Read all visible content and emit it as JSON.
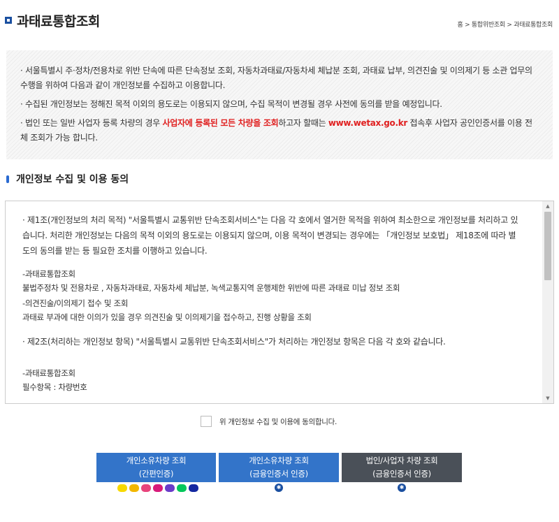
{
  "header": {
    "title": "과태료통합조회",
    "breadcrumb": "홈 > 통합위반조회 > 과태료통합조회"
  },
  "notice": {
    "line1": "· 서울특별시 주·정차/전용차로 위반 단속에 따른 단속정보 조회, 자동차과태료/자동차세 체납분 조회, 과태료 납부, 의견진술 및 이의제기 등 소관 업무의 수행을 위하여 다음과 같이 개인정보를 수집하고 이용합니다.",
    "line2": "· 수집된 개인정보는 정해진 목적 이외의 용도로는 이용되지 않으며, 수집 목적이 변경될 경우 사전에 동의를 받을 예정입니다.",
    "line3_a": "· 법인 또는 일반 사업자 등록 차량의 경우 ",
    "line3_red": "사업자에 등록된 모든 차량을 조회",
    "line3_b": "하고자 할때는 ",
    "line3_link": "www.wetax.go.kr",
    "line3_c": " 접속후 사업자 공인인증서를 이용 전체 조회가 가능 합니다."
  },
  "section": {
    "title": "개인정보 수집 및 이용 동의"
  },
  "agreement": {
    "p1": "· 제1조(개인정보의 처리 목적) \"서울특별시 교통위반 단속조회서비스\"는 다음 각 호에서 열거한 목적을 위하여 최소한으로 개인정보를 처리하고 있습니다. 처리한 개인정보는 다음의 목적 이외의 용도로는 이용되지 않으며, 이용 목적이 변경되는 경우에는 「개인정보 보호법」 제18조에 따라 별도의 동의를 받는 등 필요한 조치를 이행하고 있습니다.",
    "i1_title": "-과태료통합조회",
    "i1_desc": "  불법주정차 및 전용차로 , 자동차과태료, 자동차세 체납분, 녹색교통지역 운행제한 위반에 따른 과태료 미납 정보 조회",
    "i2_title": "-의견진술/이의제기 접수 및 조회",
    "i2_desc": "  과태료 부과에 대한 이의가 있을 경우 의견진술 및 이의제기을 접수하고, 진행 상황을 조회",
    "p2": "· 제2조(처리하는 개인정보 항목) \"서울특별시 교통위반 단속조회서비스\"가 처리하는 개인정보 항목은 다음 각 호와 같습니다.",
    "i3_title": "-과태료통합조회",
    "i3_desc": "  필수항목 : 차량번호"
  },
  "consent": {
    "label": "위 개인정보 수집 및 이용에 동의합니다."
  },
  "buttons": [
    {
      "line1": "개인소유차량 조회",
      "line2": "(간편인증)"
    },
    {
      "line1": "개인소유차량 조회",
      "line2": "(금융인증서 인증)"
    },
    {
      "line1": "법인/사업자 차량 조회",
      "line2": "(금융인증서 인증)"
    }
  ],
  "colors": {
    "primary_button": "#3374c9",
    "secondary_button": "#4a5058",
    "highlight_red": "#e02020"
  },
  "icons": {
    "auth_providers": [
      "kakao-icon",
      "kb-icon",
      "toss-icon",
      "pass-icon",
      "payco-icon",
      "naver-icon",
      "samsung-icon"
    ]
  }
}
